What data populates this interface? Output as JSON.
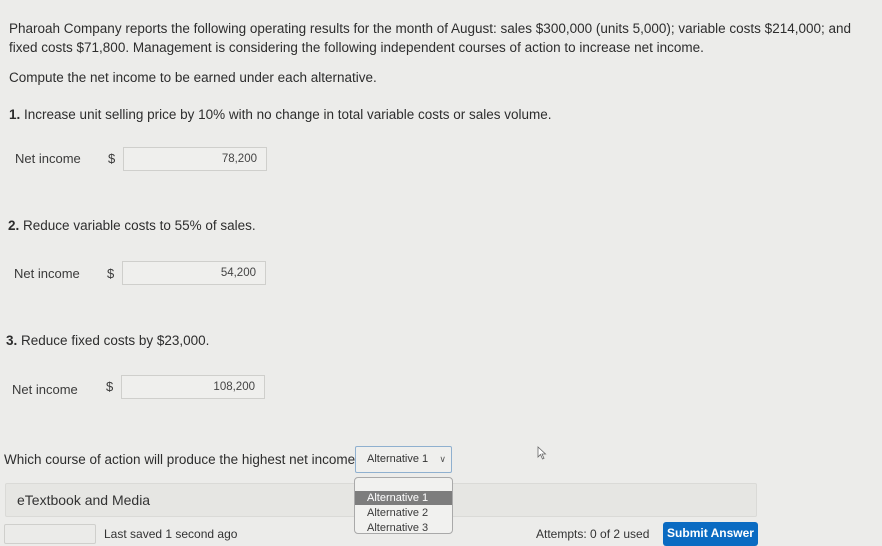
{
  "problem": {
    "intro": "Pharoah Company reports the following operating results for the month of August: sales $300,000 (units 5,000); variable costs $214,000; and fixed costs $71,800. Management is considering the following independent courses of action to increase net income.",
    "instruction": "Compute the net income to be earned under each alternative."
  },
  "alternatives": [
    {
      "number": "1.",
      "text": "Increase unit selling price by 10% with no change in total variable costs or sales volume.",
      "field_label": "Net income",
      "currency": "$",
      "value": "78,200"
    },
    {
      "number": "2.",
      "text": "Reduce variable costs to 55% of sales.",
      "field_label": "Net income",
      "currency": "$",
      "value": "54,200"
    },
    {
      "number": "3.",
      "text": "Reduce fixed costs by $23,000.",
      "field_label": "Net income",
      "currency": "$",
      "value": "108,200"
    }
  ],
  "highest": {
    "question": "Which course of action will produce the highest net income?",
    "selected": "Alternative 1",
    "chevron_icon": "chevron-down-icon",
    "options": [
      "Alternative 1",
      "Alternative 2",
      "Alternative 3"
    ],
    "highlighted_option": "Alternative 1"
  },
  "etextbook": {
    "label": "eTextbook and Media"
  },
  "footer": {
    "last_saved": "Last saved 1 second ago",
    "attempts": "Attempts: 0 of 2 used",
    "submit_label": "Submit Answer"
  },
  "colors": {
    "submit_button": "#0a6bc2",
    "highlighted_option": "#7d7d7d",
    "select_border": "#8fb0cf"
  }
}
